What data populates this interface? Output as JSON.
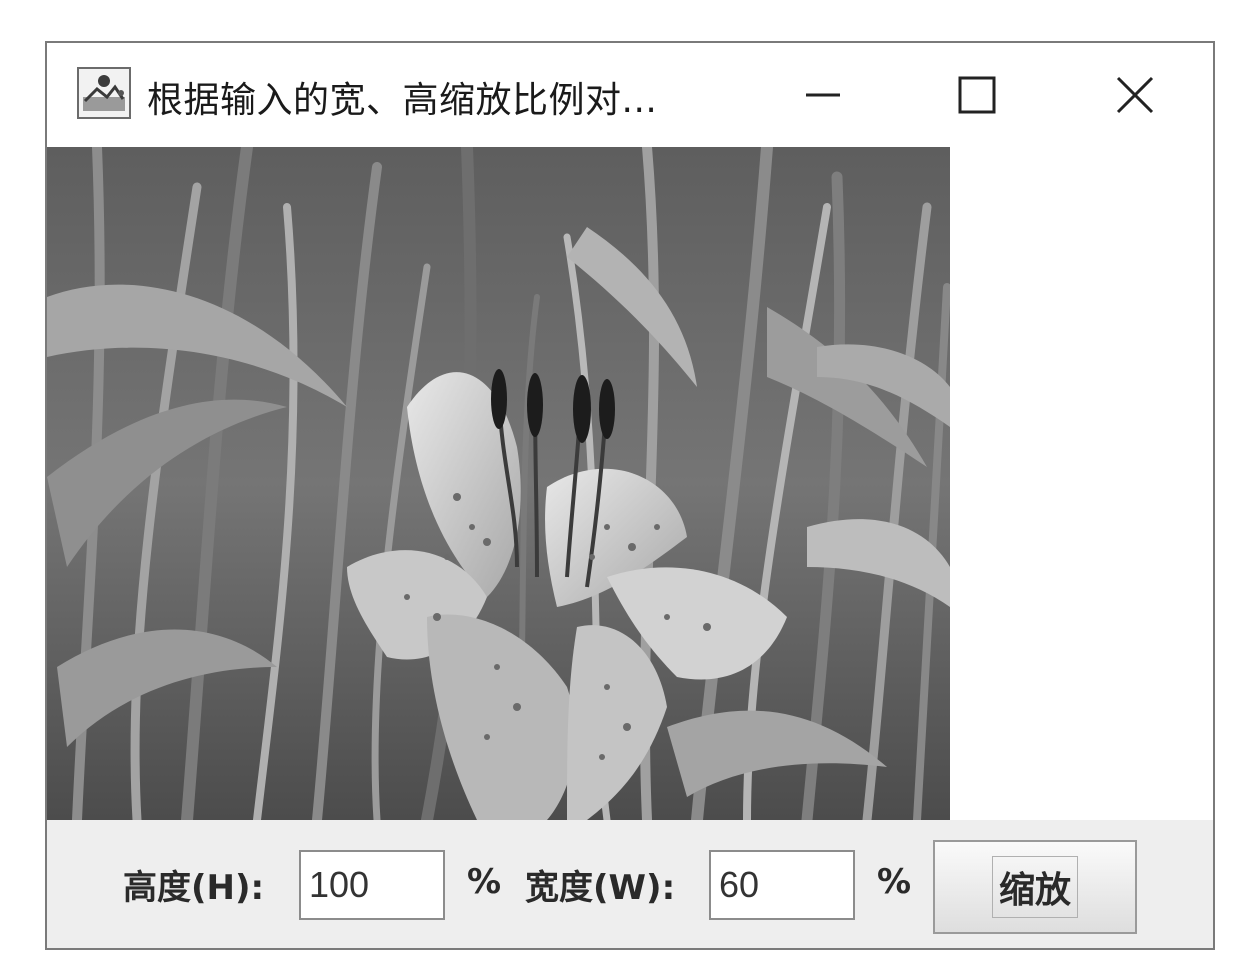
{
  "window": {
    "title": "根据输入的宽、高缩放比例对..."
  },
  "controls": {
    "height_label": "高度(H):",
    "height_value": "100",
    "height_unit": "%",
    "width_label": "宽度(W):",
    "width_value": "60",
    "width_unit": "%",
    "zoom_button": "缩放"
  },
  "icons": {
    "app": "app-icon",
    "minimize": "minimize-icon",
    "maximize": "maximize-icon",
    "close": "close-icon"
  }
}
